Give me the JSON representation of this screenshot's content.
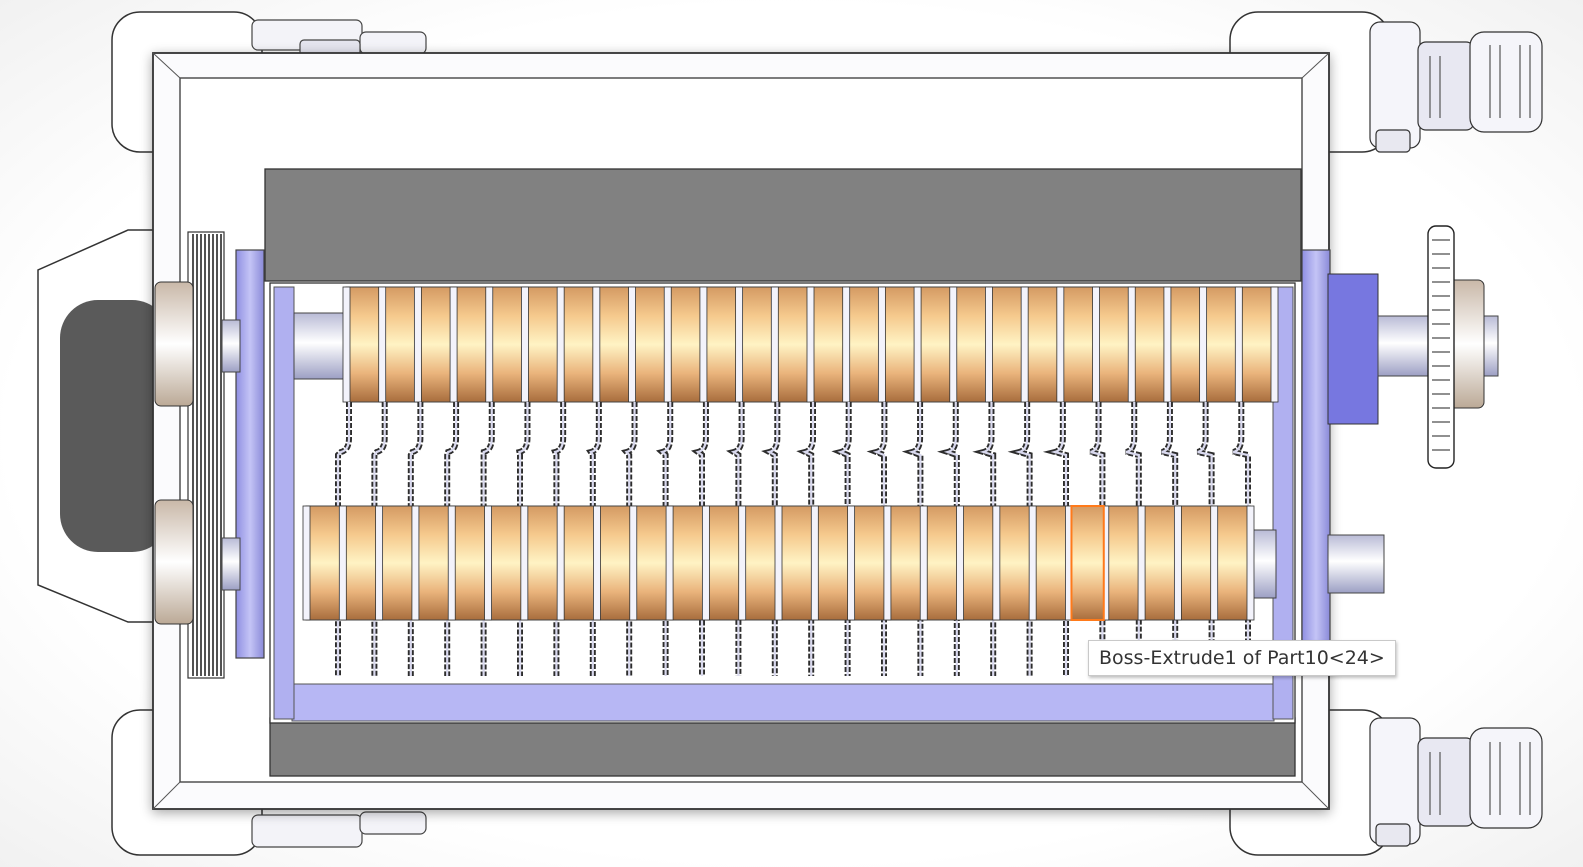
{
  "viewport": {
    "model": "shredder-assembly-top-view",
    "tooltip": {
      "text": "Boss-Extrude1 of Part10<24>"
    },
    "highlighted_component": "blade-24",
    "colors": {
      "frame_dark": "#7e7e7e",
      "bearing_blue": "#a9a9ee",
      "blade_highlight": "#ff7a1a",
      "tooltip_text": "#333333"
    },
    "upper_roller_blade_count": 26,
    "lower_roller_blade_count": 26
  }
}
